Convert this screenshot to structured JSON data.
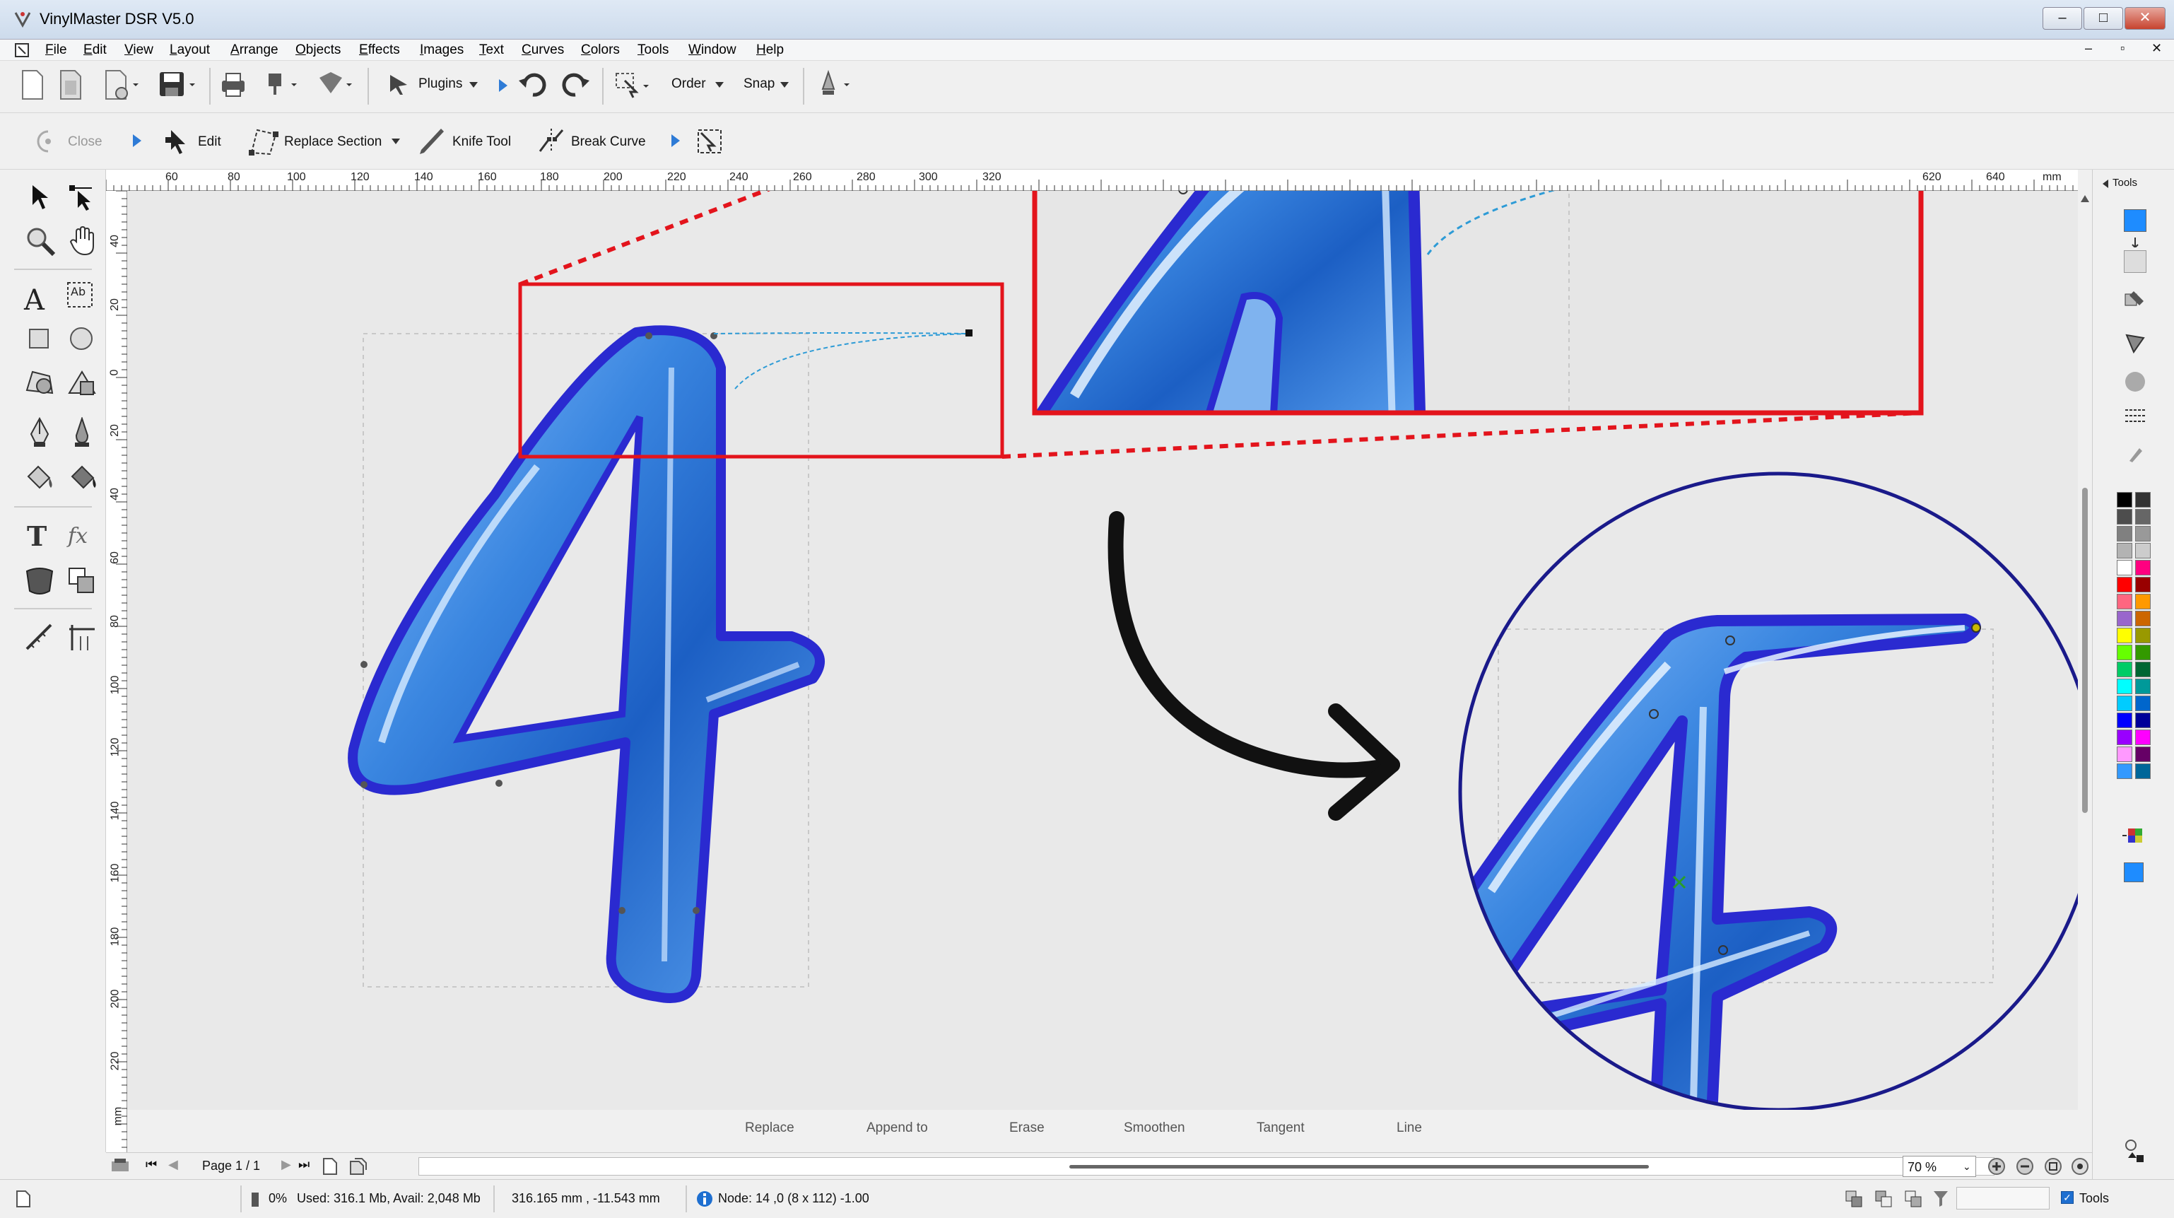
{
  "window": {
    "title": "VinylMaster DSR V5.0",
    "minimize": "–",
    "maximize": "□",
    "close": "✕"
  },
  "menu": [
    "File",
    "Edit",
    "View",
    "Layout",
    "Arrange",
    "Objects",
    "Effects",
    "Images",
    "Text",
    "Curves",
    "Colors",
    "Tools",
    "Window",
    "Help"
  ],
  "toolbar_main": {
    "plugins": "Plugins",
    "order": "Order",
    "snap": "Snap"
  },
  "toolbar_node": {
    "close": "Close",
    "edit": "Edit",
    "replace_section": "Replace Section",
    "knife_tool": "Knife Tool",
    "break_curve": "Break Curve"
  },
  "ruler": {
    "h_ticks": [
      "60",
      "80",
      "100",
      "120",
      "140",
      "160",
      "180",
      "200",
      "220",
      "240",
      "260",
      "280",
      "300",
      "320",
      "620",
      "640",
      "mm"
    ],
    "v_ticks": [
      "40",
      "20",
      "0",
      "20",
      "40",
      "60",
      "80",
      "100",
      "120",
      "140",
      "160",
      "180",
      "200",
      "220",
      "mm"
    ]
  },
  "canvas_modes": [
    "Replace",
    "Append to",
    "Erase",
    "Smoothen",
    "Tangent",
    "Line"
  ],
  "page_nav": {
    "label": "Page 1 / 1"
  },
  "zoom": {
    "value": "70 %"
  },
  "right_panel": {
    "tab": "Tools"
  },
  "status": {
    "progress": "0%",
    "memory": "Used: 316.1 Mb, Avail: 2,048 Mb",
    "coords": "316.165 mm , -11.543 mm",
    "node": "Node: 14 ,0  (8 x 112) -1.00",
    "tools_check": "Tools"
  },
  "colors": {
    "accent": "#1e8cff",
    "highlight_red": "#e3141c",
    "glyph_blue": "#3a7fd9",
    "glyph_outline": "#2a2ad0",
    "circle_stroke": "#1a1a8a"
  },
  "palette": [
    "#000000",
    "#333333",
    "#4d4d4d",
    "#666666",
    "#808080",
    "#999999",
    "#b3b3b3",
    "#cccccc",
    "#ffffff",
    "#ff0080",
    "#ff0000",
    "#990000",
    "#ff6680",
    "#ff9900",
    "#9966cc",
    "#cc6600",
    "#ffff00",
    "#999900",
    "#66ff00",
    "#339900",
    "#00cc66",
    "#006633",
    "#00ffff",
    "#009999",
    "#00ccff",
    "#0066cc",
    "#0000ff",
    "#000099",
    "#9900ff",
    "#ff00ff",
    "#ff99ff",
    "#660066",
    "#3399ff",
    "#006699"
  ]
}
